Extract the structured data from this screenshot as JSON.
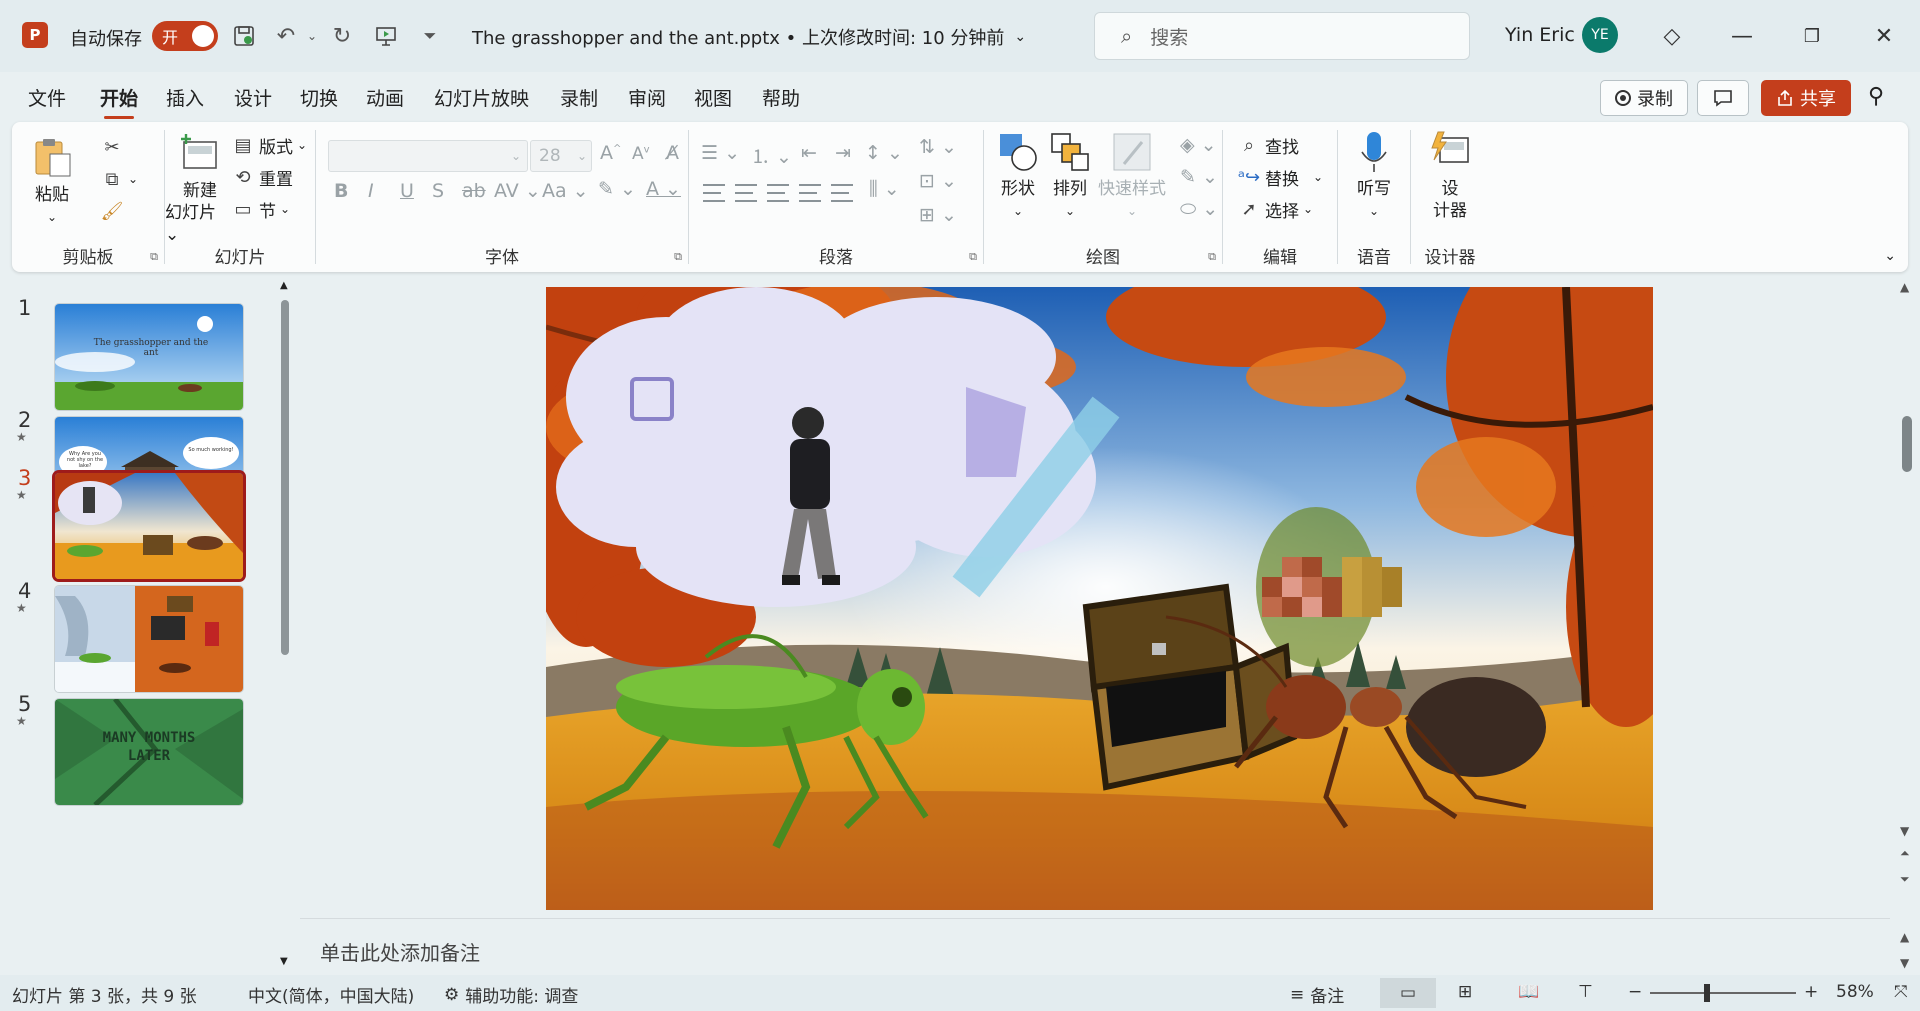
{
  "titlebar": {
    "autosave_label": "自动保存",
    "autosave_state": "开",
    "doc_title": "The grasshopper and the ant.pptx • 上次修改时间: 10 分钟前",
    "search_placeholder": "搜索",
    "user_name": "Yin Eric",
    "avatar_initials": "YE"
  },
  "menu": {
    "tabs": [
      "文件",
      "开始",
      "插入",
      "设计",
      "切换",
      "动画",
      "幻灯片放映",
      "录制",
      "审阅",
      "视图",
      "帮助"
    ],
    "active_tab": "开始",
    "record_label": "录制",
    "share_label": "共享"
  },
  "ribbon": {
    "clipboard": {
      "label": "剪贴板",
      "paste": "粘贴"
    },
    "slides": {
      "label": "幻灯片",
      "new_slide_line1": "新建",
      "new_slide_line2": "幻灯片",
      "layout": "版式",
      "reset": "重置",
      "section": "节"
    },
    "font": {
      "label": "字体",
      "font_size": "28"
    },
    "paragraph": {
      "label": "段落"
    },
    "drawing": {
      "label": "绘图",
      "shapes": "形状",
      "arrange": "排列",
      "quick_styles": "快速样式"
    },
    "editing": {
      "label": "编辑",
      "find": "查找",
      "replace": "替换",
      "select": "选择"
    },
    "voice": {
      "label": "语音",
      "dictate": "听写"
    },
    "designer": {
      "label": "设计器",
      "designer_line1": "设",
      "designer_line2": "计器"
    }
  },
  "thumbnails": [
    {
      "num": "1",
      "title_text": "The grasshopper and the ant"
    },
    {
      "num": "2",
      "bubble_left": "Why Are you not shy on the lake?",
      "bubble_right": "So much working!"
    },
    {
      "num": "3"
    },
    {
      "num": "4"
    },
    {
      "num": "5",
      "caption": "MANY MONTHS LATER"
    }
  ],
  "active_slide": 3,
  "notes_placeholder": "单击此处添加备注",
  "status": {
    "slide_info": "幻灯片 第 3 张，共 9 张",
    "language": "中文(简体，中国大陆)",
    "accessibility": "辅助功能: 调查",
    "notes": "备注",
    "zoom": "58%",
    "zoom_fraction": 0.39
  },
  "colors": {
    "accent": "#c43e1c",
    "active_thumb_border": "#9e1b1b"
  }
}
